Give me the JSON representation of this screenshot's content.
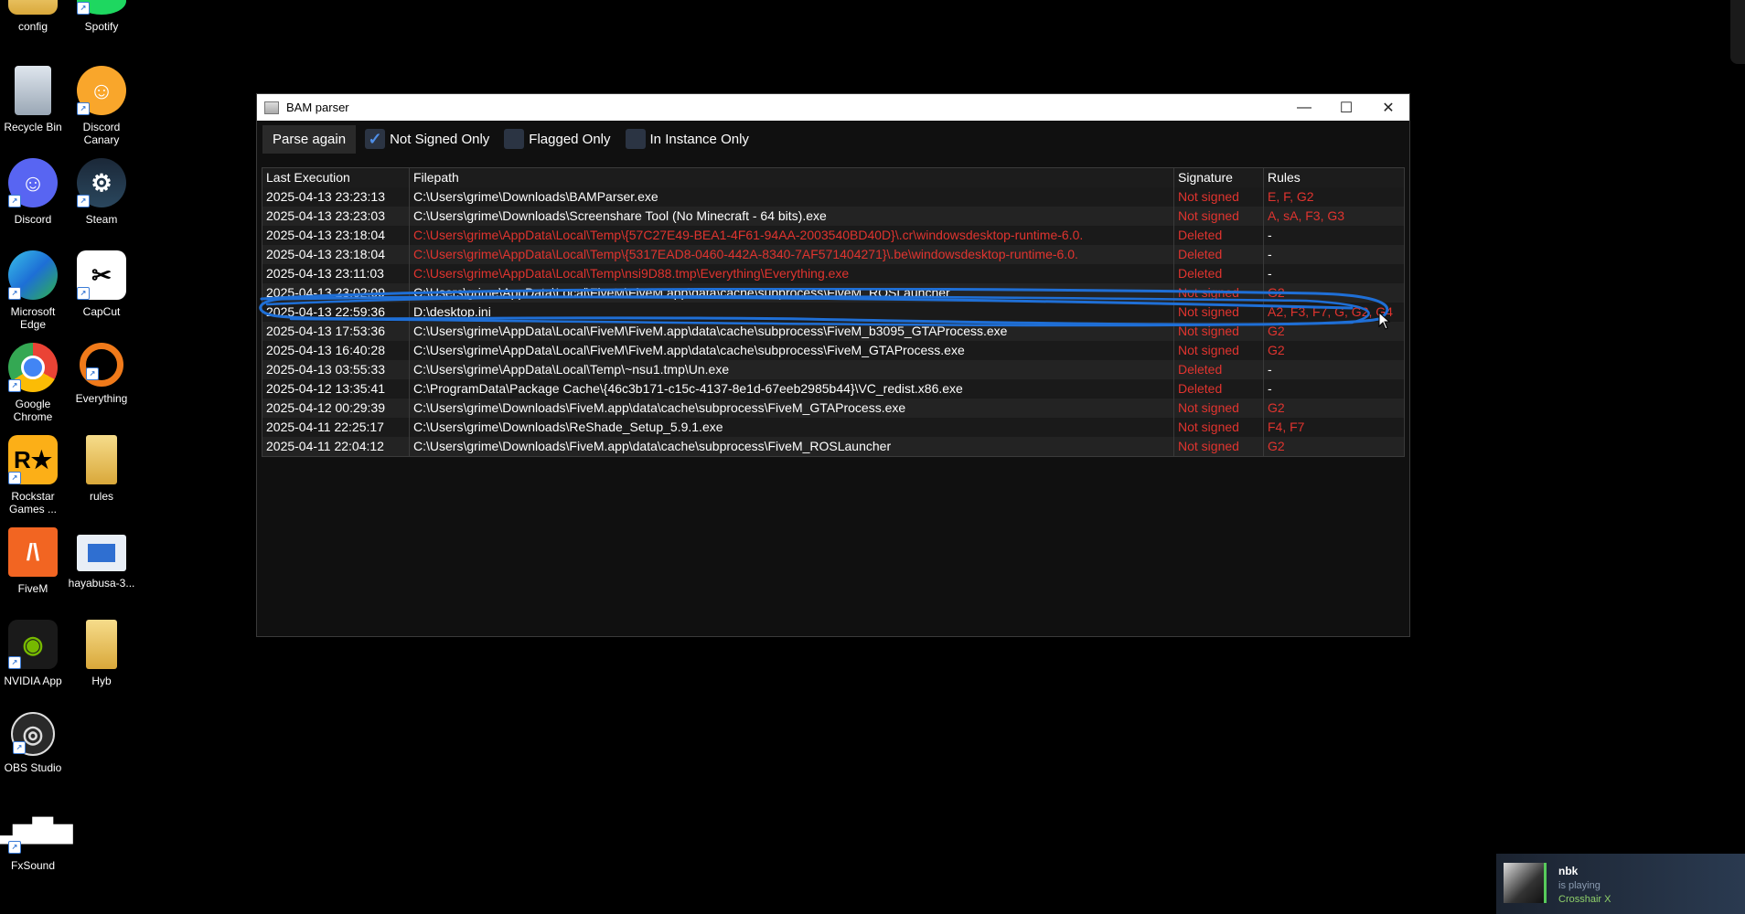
{
  "desktop": {
    "icons": [
      {
        "label": "config"
      },
      {
        "label": "Spotify"
      },
      {
        "label": "Recycle Bin"
      },
      {
        "label": "Discord Canary"
      },
      {
        "label": "Discord"
      },
      {
        "label": "Steam"
      },
      {
        "label": "Microsoft Edge"
      },
      {
        "label": "CapCut"
      },
      {
        "label": "Google Chrome"
      },
      {
        "label": "Everything"
      },
      {
        "label": "Rockstar Games ..."
      },
      {
        "label": "rules"
      },
      {
        "label": "FiveM"
      },
      {
        "label": "hayabusa-3..."
      },
      {
        "label": "NVIDIA App"
      },
      {
        "label": "Hyb"
      },
      {
        "label": "OBS Studio"
      },
      {
        "label": "FxSound"
      }
    ]
  },
  "window": {
    "title": "BAM parser",
    "controls": {
      "minimize": "—",
      "maximize": "☐",
      "close": "✕"
    }
  },
  "toolbar": {
    "parse_label": "Parse again",
    "not_signed_label": "Not Signed Only",
    "flagged_label": "Flagged Only",
    "instance_label": "In Instance Only",
    "not_signed_checked": true,
    "flagged_checked": false,
    "instance_checked": false
  },
  "table": {
    "headers": [
      "Last Execution",
      "Filepath",
      "Signature",
      "Rules"
    ],
    "rows": [
      {
        "time": "2025-04-13 23:23:13",
        "path": "C:\\Users\\grime\\Downloads\\BAMParser.exe",
        "sig": "Not signed",
        "rules": "E, F, G2",
        "path_red": false
      },
      {
        "time": "2025-04-13 23:23:03",
        "path": "C:\\Users\\grime\\Downloads\\Screenshare Tool (No Minecraft - 64 bits).exe",
        "sig": "Not signed",
        "rules": "A, sA, F3, G3",
        "path_red": false
      },
      {
        "time": "2025-04-13 23:18:04",
        "path": "C:\\Users\\grime\\AppData\\Local\\Temp\\{57C27E49-BEA1-4F61-94AA-2003540BD40D}\\.cr\\windowsdesktop-runtime-6.0.",
        "sig": "Deleted",
        "rules": "-",
        "path_red": true
      },
      {
        "time": "2025-04-13 23:18:04",
        "path": "C:\\Users\\grime\\AppData\\Local\\Temp\\{5317EAD8-0460-442A-8340-7AF571404271}\\.be\\windowsdesktop-runtime-6.0.",
        "sig": "Deleted",
        "rules": "-",
        "path_red": true
      },
      {
        "time": "2025-04-13 23:11:03",
        "path": "C:\\Users\\grime\\AppData\\Local\\Temp\\nsi9D88.tmp\\Everything\\Everything.exe",
        "sig": "Deleted",
        "rules": "-",
        "path_red": true
      },
      {
        "time": "2025-04-13 23:02:09",
        "path": "C:\\Users\\grime\\AppData\\Local\\FiveM\\FiveM.app\\data\\cache\\subprocess\\FiveM_ROSLauncher",
        "sig": "Not signed",
        "rules": "G2",
        "path_red": false
      },
      {
        "time": "2025-04-13 22:59:36",
        "path": "D:\\desktop.ini",
        "sig": "Not signed",
        "rules": "A2, F3, F7, G, G2, G4",
        "path_red": false
      },
      {
        "time": "2025-04-13 17:53:36",
        "path": "C:\\Users\\grime\\AppData\\Local\\FiveM\\FiveM.app\\data\\cache\\subprocess\\FiveM_b3095_GTAProcess.exe",
        "sig": "Not signed",
        "rules": "G2",
        "path_red": false
      },
      {
        "time": "2025-04-13 16:40:28",
        "path": "C:\\Users\\grime\\AppData\\Local\\FiveM\\FiveM.app\\data\\cache\\subprocess\\FiveM_GTAProcess.exe",
        "sig": "Not signed",
        "rules": "G2",
        "path_red": false
      },
      {
        "time": "2025-04-13 03:55:33",
        "path": "C:\\Users\\grime\\AppData\\Local\\Temp\\~nsu1.tmp\\Un.exe",
        "sig": "Deleted",
        "rules": "-",
        "path_red": false
      },
      {
        "time": "2025-04-12 13:35:41",
        "path": "C:\\ProgramData\\Package Cache\\{46c3b171-c15c-4137-8e1d-67eeb2985b44}\\VC_redist.x86.exe",
        "sig": "Deleted",
        "rules": "-",
        "path_red": false
      },
      {
        "time": "2025-04-12 00:29:39",
        "path": "C:\\Users\\grime\\Downloads\\FiveM.app\\data\\cache\\subprocess\\FiveM_GTAProcess.exe",
        "sig": "Not signed",
        "rules": "G2",
        "path_red": false
      },
      {
        "time": "2025-04-11 22:25:17",
        "path": "C:\\Users\\grime\\Downloads\\ReShade_Setup_5.9.1.exe",
        "sig": "Not signed",
        "rules": "F4, F7",
        "path_red": false
      },
      {
        "time": "2025-04-11 22:04:12",
        "path": "C:\\Users\\grime\\Downloads\\FiveM.app\\data\\cache\\subprocess\\FiveM_ROSLauncher",
        "sig": "Not signed",
        "rules": "G2",
        "path_red": false
      }
    ]
  },
  "notification": {
    "user": "nbk",
    "status": "is playing",
    "game": "Crosshair X"
  },
  "colors": {
    "accent_red": "#e0342f",
    "annotation_blue": "#1f6fd6",
    "check_blue": "#4f8fe8"
  }
}
